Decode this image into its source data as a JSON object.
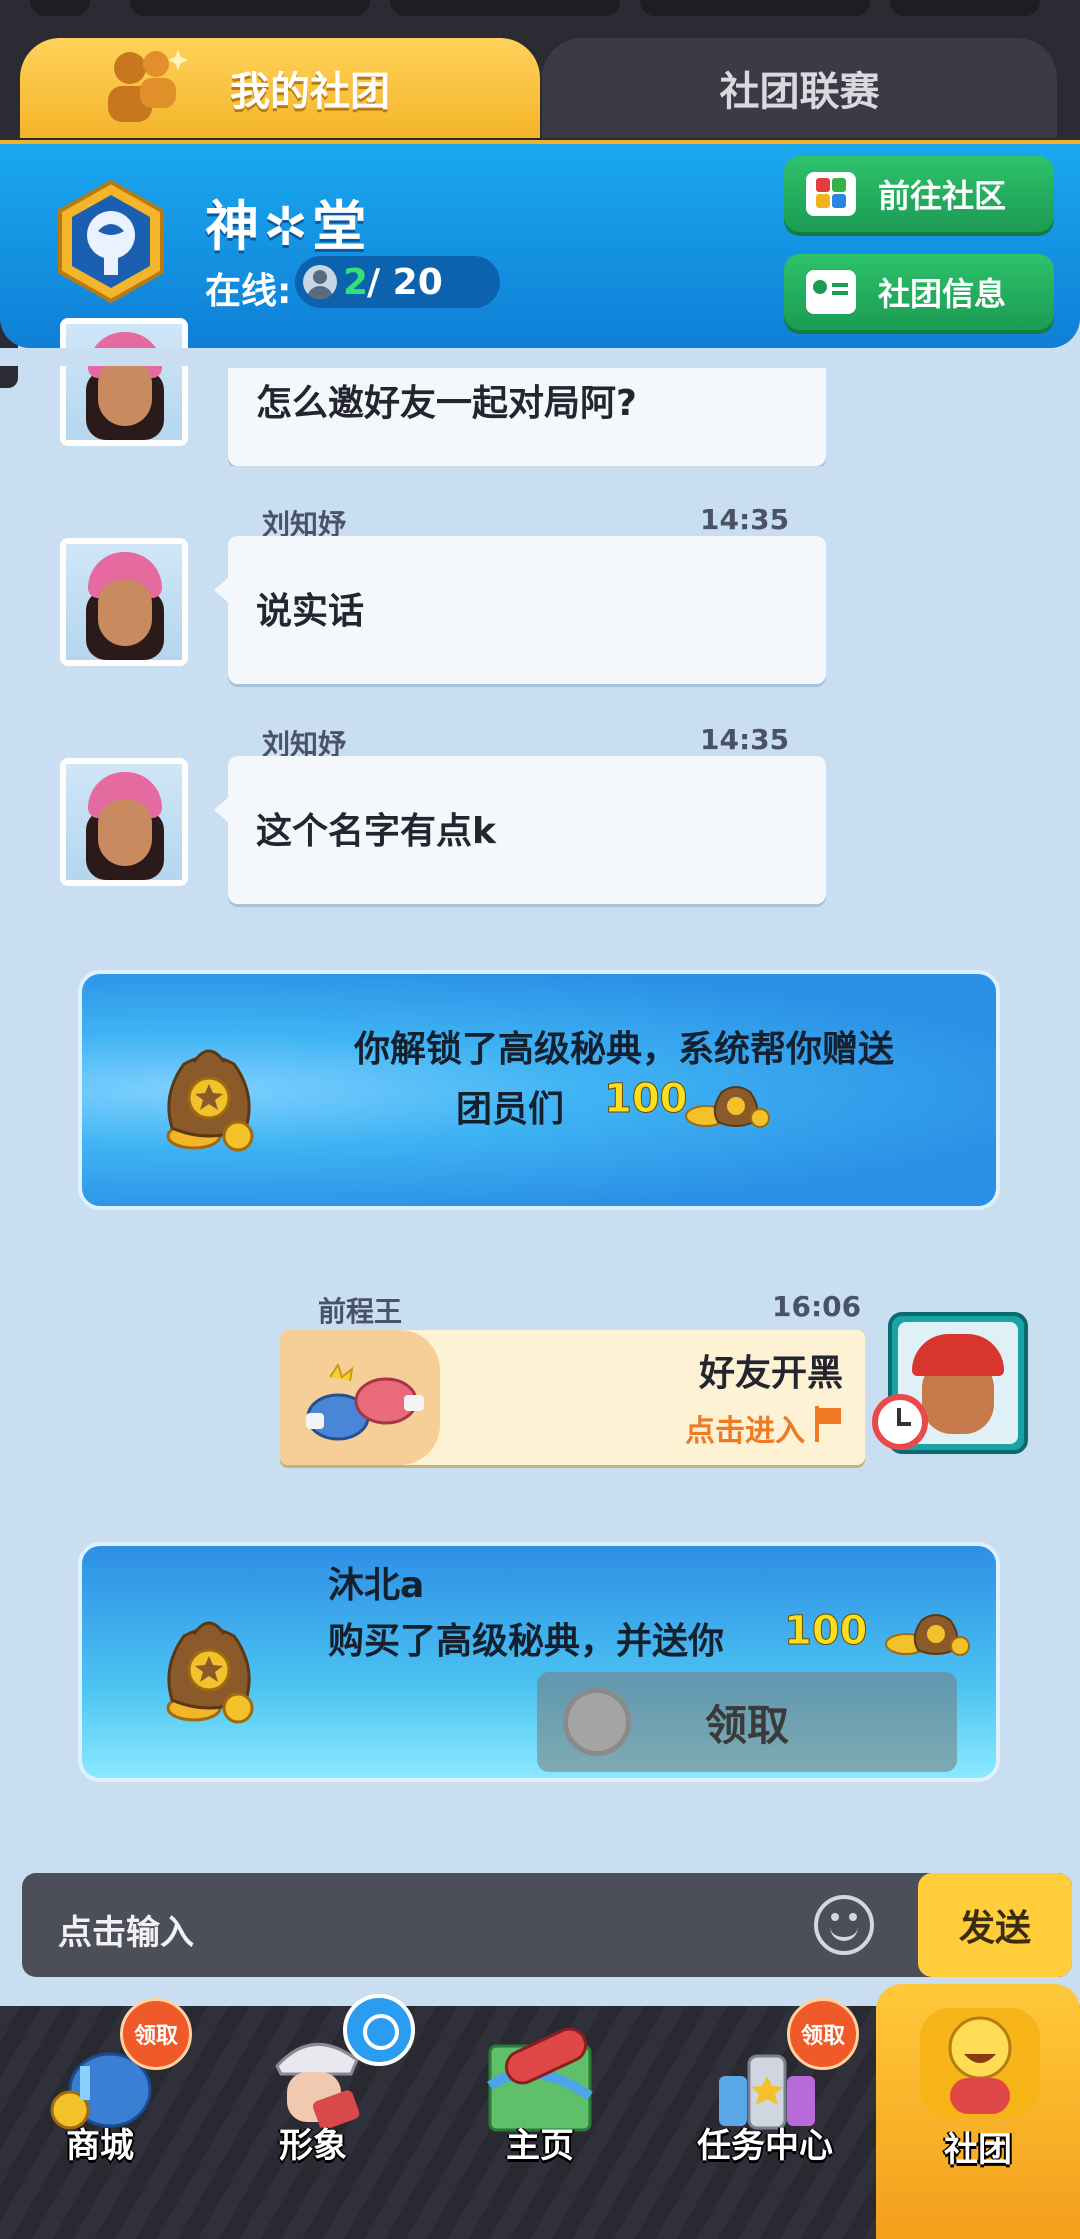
{
  "tabs": {
    "my_club": "我的社团",
    "league": "社团联赛"
  },
  "club": {
    "name": "神✲堂",
    "online_label": "在线:",
    "online_count": "2",
    "online_total": "/ 20",
    "btn_community": "前往社区",
    "btn_info": "社团信息"
  },
  "messages": [
    {
      "sender": "",
      "time": "",
      "text": "怎么邀好友一起对局阿?"
    },
    {
      "sender": "刘知妤",
      "time": "14:35",
      "text": "说实话"
    },
    {
      "sender": "刘知妤",
      "time": "14:35",
      "text": "这个名字有点k"
    }
  ],
  "system1": {
    "line1": "你解锁了高级秘典，系统帮你赠送",
    "line2": "团员们",
    "amount": "100"
  },
  "friend_play": {
    "sender": "前程王",
    "time": "16:06",
    "title": "好友开黑",
    "enter": "点击进入"
  },
  "system2": {
    "user": "沐北a",
    "line": "购买了高级秘典，并送你",
    "amount": "100",
    "claim": "领取"
  },
  "input": {
    "placeholder": "点击输入",
    "send": "发送"
  },
  "nav": {
    "shop": "商城",
    "avatar": "形象",
    "home": "主页",
    "tasks": "任务中心",
    "club": "社团",
    "claim_badge": "领取"
  },
  "colors": {
    "tab_active": "#f3b529",
    "header_blue": "#1aa8ef",
    "green_button": "#2ec26b",
    "send_yellow": "#ffce3a",
    "online_green": "#34e07a"
  }
}
